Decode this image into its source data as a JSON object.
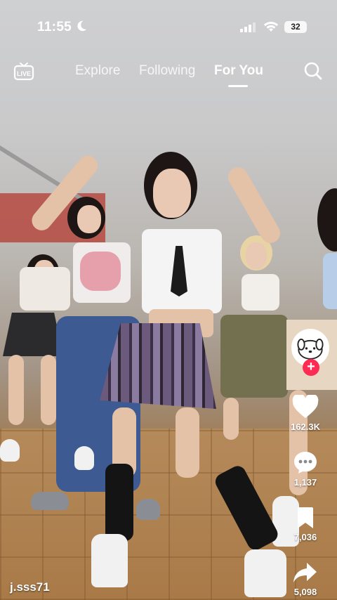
{
  "status_bar": {
    "time": "11:55",
    "battery": "32"
  },
  "top_nav": {
    "tabs": [
      {
        "label": "Explore",
        "active": false
      },
      {
        "label": "Following",
        "active": false
      },
      {
        "label": "For You",
        "active": true
      }
    ],
    "live_label": "LIVE"
  },
  "actions": {
    "likes": "162.3K",
    "comments": "1,137",
    "saves": "7,036",
    "shares": "5,098"
  },
  "video": {
    "username": "j.sss71"
  },
  "colors": {
    "accent": "#fe2c55"
  }
}
